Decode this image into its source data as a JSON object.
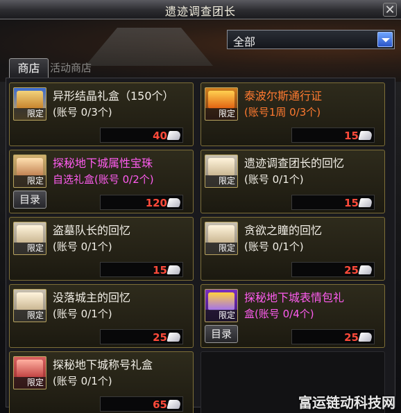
{
  "window": {
    "title": "遗迹调查团长"
  },
  "filter": {
    "selected": "全部"
  },
  "tabs": [
    {
      "label": "商店"
    },
    {
      "label": "活动商店"
    }
  ],
  "items": [
    {
      "name": "异形结晶礼盒（150个）",
      "limit": "(账号 0/3个)",
      "price": "40",
      "badge": "限定",
      "color": "#f2efe7"
    },
    {
      "name": "泰波尔斯通行证",
      "limit": "(账号1周 0/3个)",
      "price": "15",
      "badge": "限定",
      "color": "#ff7a30"
    },
    {
      "name": "探秘地下城属性宝珠",
      "limit": "自选礼盒(账号 0/2个)",
      "price": "120",
      "badge": "限定",
      "color": "#ff5cf0",
      "catalog": "目录"
    },
    {
      "name": "遗迹调查团长的回忆",
      "limit": "(账号 0/1个)",
      "price": "15",
      "badge": "限定",
      "color": "#f2efe7"
    },
    {
      "name": "盗墓队长的回忆",
      "limit": "(账号 0/1个)",
      "price": "15",
      "badge": "限定",
      "color": "#f2efe7"
    },
    {
      "name": "贪欲之瞳的回忆",
      "limit": "(账号 0/1个)",
      "price": "25",
      "badge": "限定",
      "color": "#f2efe7"
    },
    {
      "name": "没落城主的回忆",
      "limit": "(账号 0/1个)",
      "price": "25",
      "badge": "限定",
      "color": "#f2efe7"
    },
    {
      "name": "探秘地下城表情包礼",
      "limit": "盒(账号 0/4个)",
      "price": "25",
      "badge": "限定",
      "color": "#ff5cf0",
      "catalog": "目录"
    },
    {
      "name": "探秘地下城称号礼盒",
      "limit": "(账号 0/1个)",
      "price": "65",
      "badge": "限定",
      "color": "#f2efe7"
    }
  ],
  "watermark": "富运链动科技网",
  "colors": {
    "accent": "#7e6f38",
    "price": "#ff4a3a",
    "purple": "#ff5cf0",
    "orange": "#ff7a30"
  }
}
